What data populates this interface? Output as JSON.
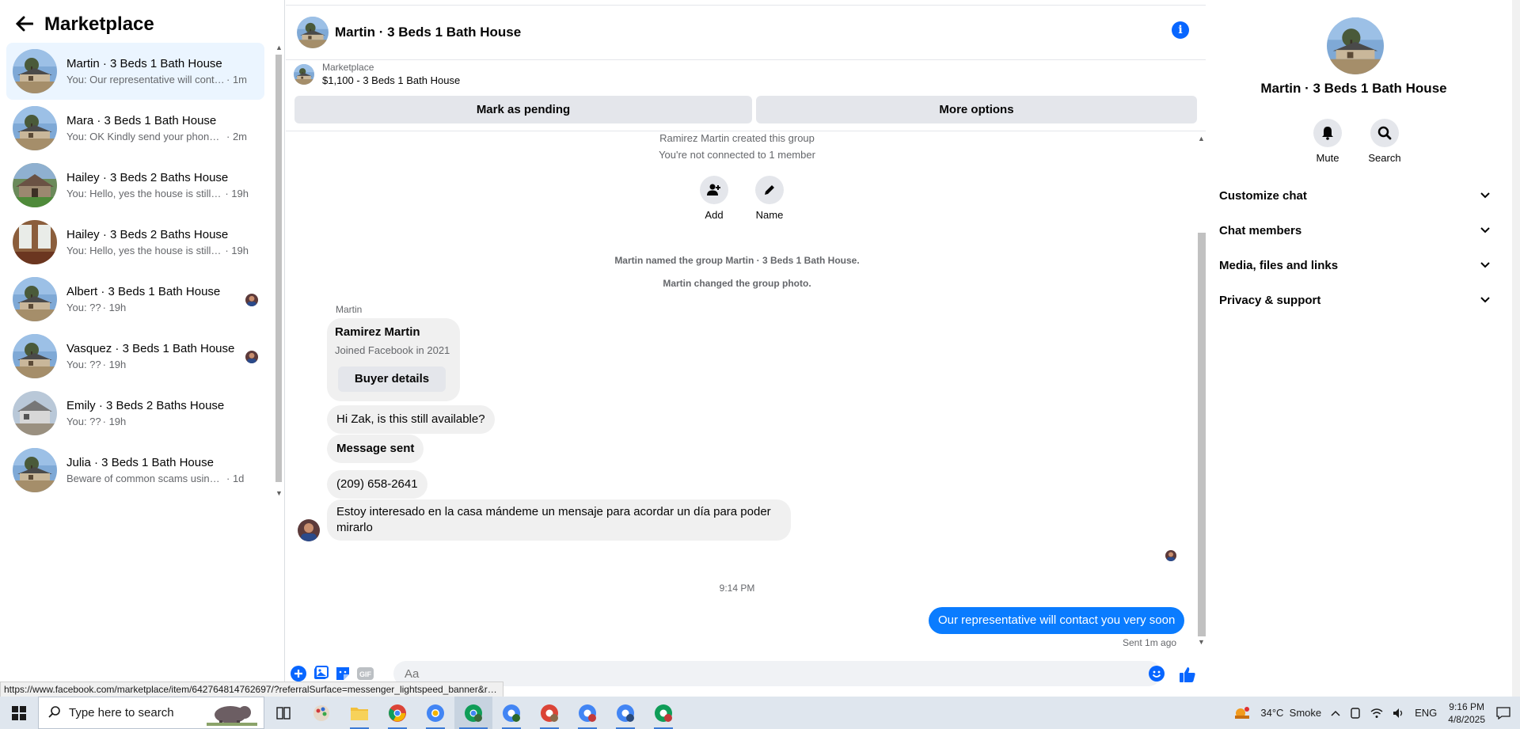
{
  "sidebar": {
    "title": "Marketplace",
    "conversations": [
      {
        "name": "Martin · 3 Beds 1 Bath House",
        "preview": "You: Our representative will conta...",
        "time": "· 1m",
        "active": true
      },
      {
        "name": "Mara · 3 Beds 1 Bath House",
        "preview": "You: OK Kindly send your phone if...",
        "time": "· 2m"
      },
      {
        "name": "Hailey · 3 Beds 2 Baths House",
        "preview": "You: Hello, yes the house is still av...",
        "time": "· 19h"
      },
      {
        "name": "Hailey · 3 Beds 2 Baths House",
        "preview": "You: Hello, yes the house is still av...",
        "time": "· 19h"
      },
      {
        "name": "Albert · 3 Beds 1 Bath House",
        "preview": "You: ??",
        "time": "· 19h"
      },
      {
        "name": "Vasquez · 3 Beds 1 Bath House",
        "preview": "You: ??",
        "time": "· 19h"
      },
      {
        "name": "Emily · 3 Beds 2 Baths House",
        "preview": "You: ??",
        "time": "· 19h"
      },
      {
        "name": "Julia · 3 Beds 1 Bath House",
        "preview": "Beware of common scams using p...",
        "time": "· 1d"
      }
    ]
  },
  "chat": {
    "title": "Martin · 3 Beds 1 Bath House",
    "marketplace_label": "Marketplace",
    "listing": "$1,100 - 3 Beds 1 Bath House",
    "mark_pending": "Mark as pending",
    "more_options": "More options",
    "sys_created": "Ramirez Martin created this group",
    "sys_connected": "You're not connected to 1 member",
    "add_label": "Add",
    "name_label": "Name",
    "sys_named": "Martin named the group Martin · 3 Beds 1 Bath House.",
    "sys_photo": "Martin changed the group photo.",
    "sender": "Martin",
    "card_name": "Ramirez Martin",
    "card_sub": "Joined Facebook in 2021",
    "card_button": "Buyer details",
    "msg1": "Hi Zak, is this still available?",
    "msg2": "Message sent",
    "msg3": "(209) 658-2641",
    "msg4": "Estoy interesado en la casa mándeme un mensaje para acordar un día para poder mirarlo",
    "time_sep": "9:14 PM",
    "out_msg": "Our representative will contact you very soon",
    "sent_status": "Sent 1m ago",
    "composer_placeholder": "Aa",
    "gif_label": "GIF"
  },
  "right_panel": {
    "title": "Martin · 3 Beds 1 Bath House",
    "mute": "Mute",
    "search": "Search",
    "sections": [
      "Customize chat",
      "Chat members",
      "Media, files and links",
      "Privacy & support"
    ]
  },
  "status_url": "https://www.facebook.com/marketplace/item/642764814762697/?referralSurface=messenger_lightspeed_banner&re...",
  "taskbar": {
    "search_placeholder": "Type here to search",
    "weather": "34°C  Smoke",
    "lang": "ENG",
    "time": "9:16 PM",
    "date": "4/8/2025"
  },
  "colors": {
    "accent": "#0866ff",
    "outgoing": "#0a7cff",
    "active_row": "#ebf5ff"
  }
}
